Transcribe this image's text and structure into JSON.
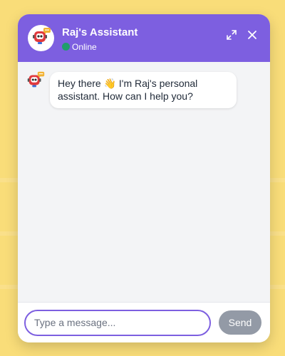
{
  "header": {
    "title": "Raj's Assistant",
    "status": "Online",
    "status_color": "#1f9d6b",
    "accent_color": "#7d5fe0",
    "avatar_icon": "robot-icon",
    "expand_icon": "expand-icon",
    "close_icon": "close-icon"
  },
  "messages": [
    {
      "sender": "assistant",
      "avatar_icon": "robot-icon",
      "text": "Hey there 👋 I'm Raj's personal assistant. How can I help you?"
    }
  ],
  "composer": {
    "placeholder": "Type a message...",
    "value": "",
    "send_label": "Send"
  }
}
